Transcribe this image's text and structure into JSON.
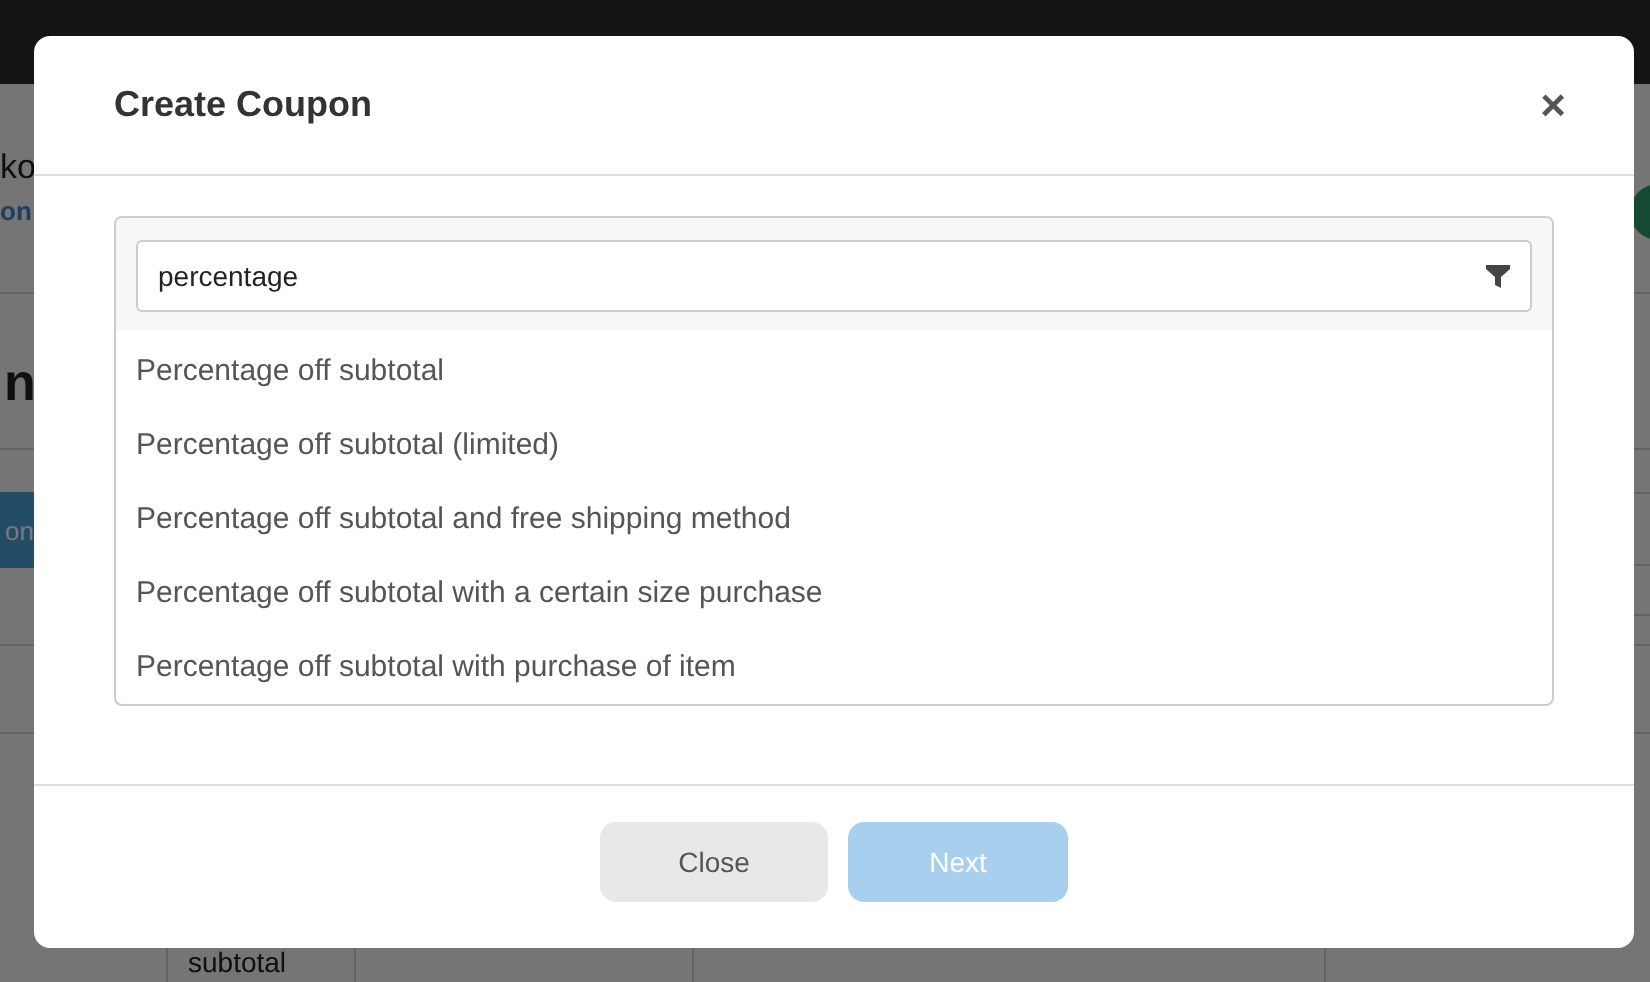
{
  "background_page": {
    "header_title": "ko",
    "header_link": "on",
    "heading": "n",
    "button": "on",
    "table_cell": "subtotal"
  },
  "dialog": {
    "title": "Create Coupon",
    "close_icon": "×",
    "search": {
      "value": "percentage"
    },
    "options": [
      {
        "label": "Percentage off subtotal"
      },
      {
        "label": "Percentage off subtotal (limited)"
      },
      {
        "label": "Percentage off subtotal and free shipping method"
      },
      {
        "label": "Percentage off subtotal with a certain size purchase"
      },
      {
        "label": "Percentage off subtotal with purchase of item"
      }
    ],
    "buttons": [
      {
        "label": "Close",
        "kind": "secondary",
        "disabled": false
      },
      {
        "label": "Next",
        "kind": "primary",
        "disabled": true
      }
    ]
  }
}
